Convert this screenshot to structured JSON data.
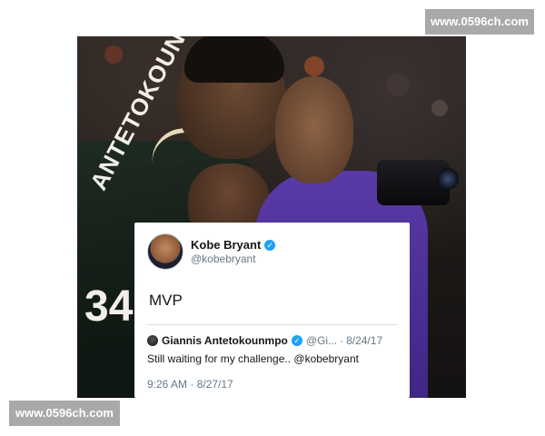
{
  "photo": {
    "jersey_text": "ANTETOKOUNM",
    "jersey_number": "34"
  },
  "tweet": {
    "author_name": "Kobe Bryant",
    "author_handle": "@kobebryant",
    "body": "MVP",
    "quoted": {
      "author_name": "Giannis Antetokounmpo",
      "author_handle": "@Gi...",
      "separator": "·",
      "date": "8/24/17",
      "text": "Still waiting for my challenge.. @kobebryant"
    },
    "timestamp": "9:26 AM · 8/27/17",
    "verified_icon": "✓"
  },
  "watermarks": {
    "top": "www.0596ch.com",
    "bottom": "www.0596ch.com"
  },
  "colors": {
    "twitter_blue": "#1da1f2",
    "lakers_purple": "#5a3aa6",
    "bucks_green": "#1e2b22",
    "watermark_gray": "#a9a9a9"
  }
}
